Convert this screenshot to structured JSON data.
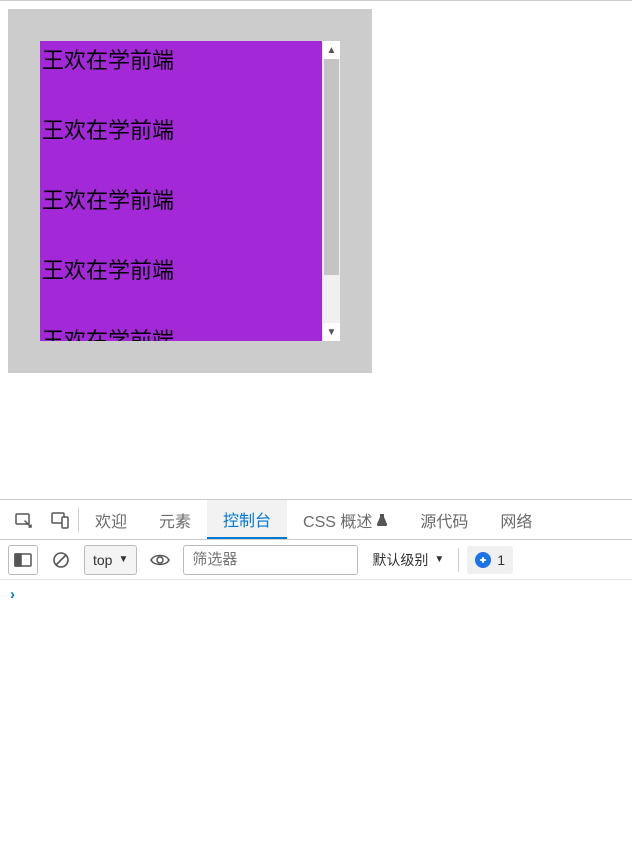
{
  "content": {
    "lines": [
      "王欢在学前端",
      "王欢在学前端",
      "王欢在学前端",
      "王欢在学前端",
      "王欢在学前端"
    ]
  },
  "devtools": {
    "tabs": {
      "welcome": "欢迎",
      "elements": "元素",
      "console": "控制台",
      "css_overview": "CSS 概述",
      "sources": "源代码",
      "network": "网络"
    },
    "toolbar": {
      "context": "top",
      "filter_placeholder": "筛选器",
      "log_level": "默认级别",
      "issue_count": "1"
    },
    "prompt": "›"
  }
}
